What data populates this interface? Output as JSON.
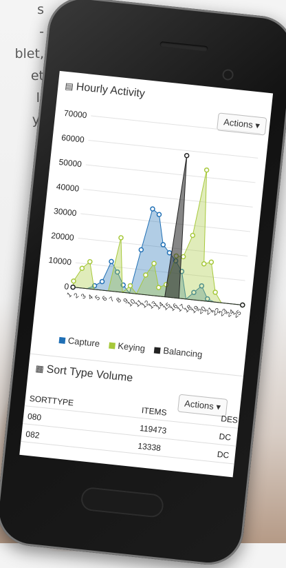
{
  "background_text": [
    "s",
    "-",
    "blet,",
    "et",
    "l,",
    "y,"
  ],
  "hourly_activity": {
    "title": "Hourly Activity",
    "actions_label": "Actions",
    "legend": [
      {
        "label": "Capture",
        "color": "#1f6fb5"
      },
      {
        "label": "Keying",
        "color": "#a6c83a"
      },
      {
        "label": "Balancing",
        "color": "#222222"
      }
    ]
  },
  "chart_data": {
    "type": "area",
    "yticks": [
      "70000",
      "60000",
      "50000",
      "40000",
      "30000",
      "20000",
      "10000",
      "0"
    ],
    "ylim": [
      0,
      70000
    ],
    "x": [
      1,
      2,
      3,
      4,
      5,
      6,
      7,
      8,
      9,
      10,
      11,
      12,
      13,
      14,
      15,
      16,
      17,
      18,
      19,
      20,
      21,
      22,
      23,
      24,
      25
    ],
    "series": [
      {
        "name": "Capture",
        "color": "#1f6fb5",
        "values": [
          0,
          0,
          0,
          1500,
          3500,
          12000,
          8000,
          3000,
          0,
          18000,
          35000,
          33000,
          21000,
          18000,
          15000,
          11000,
          0,
          3000,
          6000,
          1000,
          0,
          0,
          0,
          0,
          0
        ]
      },
      {
        "name": "Keying",
        "color": "#a6c83a",
        "values": [
          2500,
          8000,
          11000,
          0,
          0,
          0,
          22000,
          0,
          3000,
          0,
          8000,
          13000,
          3500,
          5000,
          17000,
          17000,
          26000,
          53000,
          15000,
          16000,
          4000,
          0,
          0,
          0,
          0
        ]
      },
      {
        "name": "Balancing",
        "color": "#222222",
        "values": [
          0,
          0,
          0,
          0,
          0,
          0,
          0,
          0,
          0,
          0,
          0,
          0,
          0,
          0,
          58000,
          0,
          0,
          0,
          0,
          0,
          0,
          0,
          0,
          0,
          0
        ]
      }
    ]
  },
  "sort_type_volume": {
    "title": "Sort Type Volume",
    "actions_label": "Actions",
    "columns": [
      "SORTTYPE",
      "ITEMS",
      "DES"
    ],
    "rows": [
      {
        "sorttype": "080",
        "items": "119473",
        "des": "DC"
      },
      {
        "sorttype": "082",
        "items": "13338",
        "des": "DC"
      }
    ]
  }
}
